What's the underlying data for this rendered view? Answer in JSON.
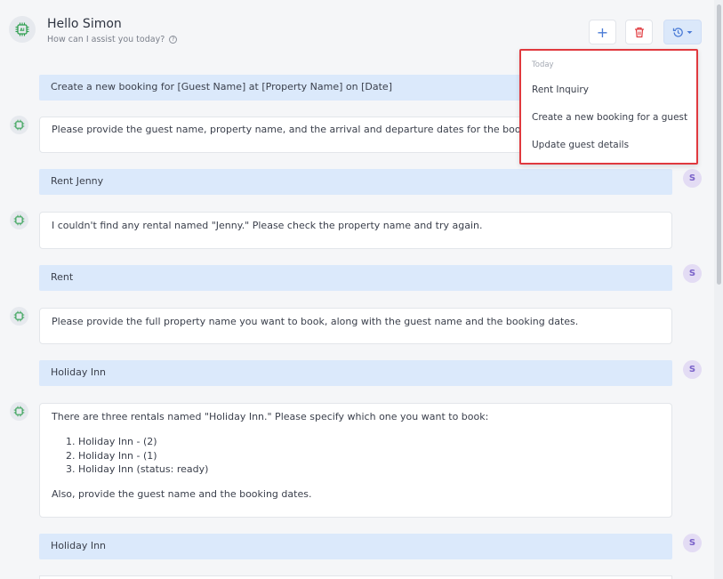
{
  "header": {
    "greeting": "Hello Simon",
    "subtitle": "How can I assist you today?",
    "help_icon_glyph": "?",
    "add_icon": "plus-icon",
    "delete_icon": "trash-icon",
    "history_icon": "history-icon",
    "add_glyph": "+",
    "colors": {
      "accent": "#4a7bd6",
      "delete": "#e0393e"
    }
  },
  "messages": [
    {
      "role": "user",
      "text": "Create a new booking for [Guest Name] at [Property Name] on [Date]",
      "avatar": ""
    },
    {
      "role": "assistant",
      "text": "Please provide the guest name, property name, and the arrival and departure dates for the booking."
    },
    {
      "role": "user",
      "text": "Rent Jenny",
      "avatar": "S"
    },
    {
      "role": "assistant",
      "text": "I couldn't find any rental named \"Jenny.\" Please check the property name and try again."
    },
    {
      "role": "user",
      "text": "Rent",
      "avatar": "S"
    },
    {
      "role": "assistant",
      "text": "Please provide the full property name you want to book, along with the guest name and the booking dates."
    },
    {
      "role": "user",
      "text": "Holiday Inn",
      "avatar": "S"
    },
    {
      "role": "assistant",
      "text": "There are three rentals named \"Holiday Inn.\" Please specify which one you want to book:",
      "list": [
        "Holiday Inn - (2)",
        "Holiday Inn - (1)",
        "Holiday Inn (status: ready)"
      ],
      "footer": "Also, provide the guest name and the booking dates."
    },
    {
      "role": "user",
      "text": "Holiday Inn",
      "avatar": "S"
    }
  ],
  "history_dropdown": {
    "section": "Today",
    "items": [
      "Rent Inquiry",
      "Create a new booking for a guest",
      "Update guest details"
    ],
    "highlight_color": "#e0393e"
  }
}
